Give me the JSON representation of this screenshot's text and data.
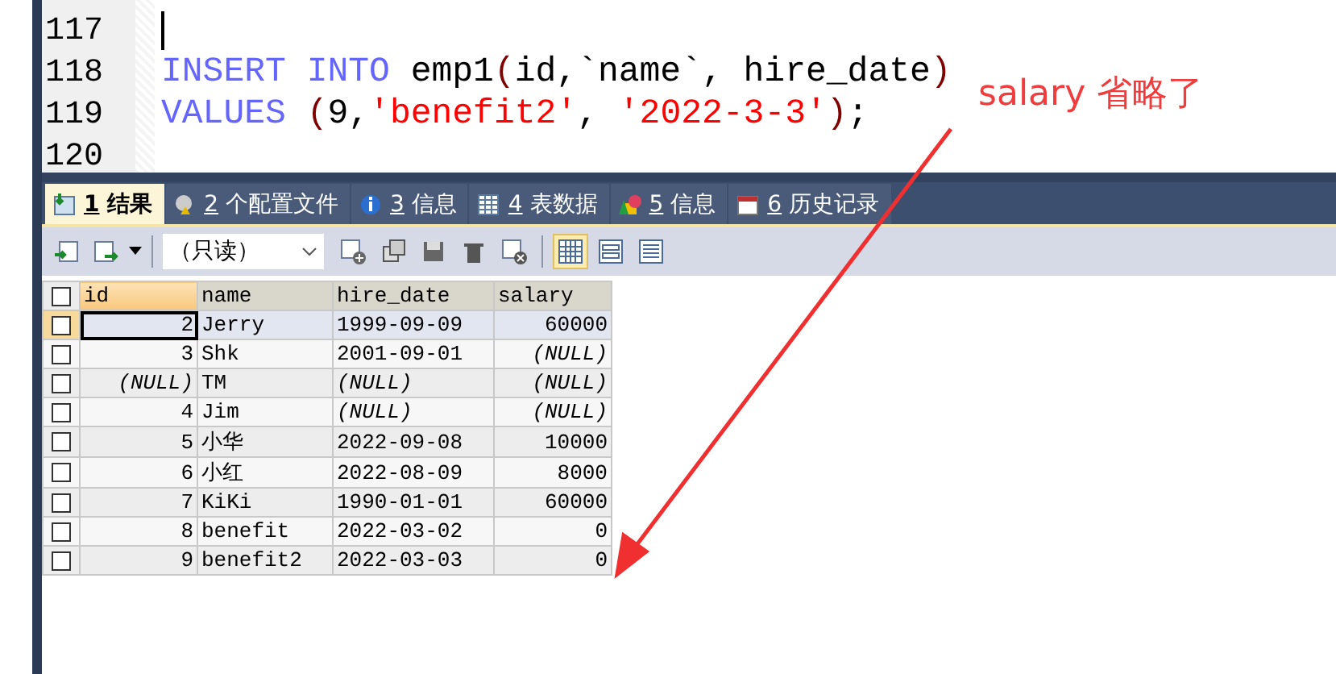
{
  "editor": {
    "lines": [
      {
        "number": "117",
        "cursor": true
      },
      {
        "number": "118",
        "cursor": false,
        "tokens": [
          {
            "kind": "keyword",
            "text": "INSERT INTO"
          },
          {
            "kind": "plain",
            "text": " emp1"
          },
          {
            "kind": "paren",
            "text": "("
          },
          {
            "kind": "plain",
            "text": "id,`name`, hire_date"
          },
          {
            "kind": "paren",
            "text": ")"
          }
        ]
      },
      {
        "number": "119",
        "cursor": false,
        "tokens": [
          {
            "kind": "keyword",
            "text": "VALUES"
          },
          {
            "kind": "paren",
            "text": " ("
          },
          {
            "kind": "plain",
            "text": "9,"
          },
          {
            "kind": "string",
            "text": "'benefit2'"
          },
          {
            "kind": "plain",
            "text": ", "
          },
          {
            "kind": "string",
            "text": "'2022-3-3'"
          },
          {
            "kind": "paren",
            "text": ")"
          },
          {
            "kind": "plain",
            "text": ";"
          }
        ]
      },
      {
        "number": "120",
        "cursor": false
      }
    ]
  },
  "annotation": {
    "text": "salary 省略了"
  },
  "tabs": [
    {
      "kind": "result",
      "number": "1",
      "label": "结果",
      "selected": true
    },
    {
      "kind": "profile",
      "number": "2",
      "label": "个配置文件",
      "selected": false
    },
    {
      "kind": "info",
      "number": "3",
      "label": "信息",
      "selected": false
    },
    {
      "kind": "table",
      "number": "4",
      "label": "表数据",
      "selected": false
    },
    {
      "kind": "shapes",
      "number": "5",
      "label": "信息",
      "selected": false
    },
    {
      "kind": "calendar",
      "number": "6",
      "label": "历史记录",
      "selected": false
    }
  ],
  "toolbar": {
    "mode": "（只读）",
    "views": [
      {
        "kind": "grid",
        "selected": true
      },
      {
        "kind": "form",
        "selected": false
      },
      {
        "kind": "text",
        "selected": false
      }
    ]
  },
  "grid": {
    "all_checked": false,
    "columns": [
      {
        "label": "id",
        "kind": "number",
        "selected": true
      },
      {
        "label": "name",
        "kind": "text",
        "selected": false
      },
      {
        "label": "hire_date",
        "kind": "text",
        "selected": false
      },
      {
        "label": "salary",
        "kind": "number",
        "selected": false
      }
    ],
    "rows": [
      {
        "selected": true,
        "checked": false,
        "cells": [
          {
            "text": "2",
            "null": false
          },
          {
            "text": "Jerry",
            "null": false
          },
          {
            "text": "1999-09-09",
            "null": false
          },
          {
            "text": "60000",
            "null": false
          }
        ]
      },
      {
        "selected": false,
        "checked": false,
        "cells": [
          {
            "text": "3",
            "null": false
          },
          {
            "text": "Shk",
            "null": false
          },
          {
            "text": "2001-09-01",
            "null": false
          },
          {
            "text": "(NULL)",
            "null": true
          }
        ]
      },
      {
        "selected": false,
        "checked": false,
        "cells": [
          {
            "text": "(NULL)",
            "null": true
          },
          {
            "text": "TM",
            "null": false
          },
          {
            "text": "(NULL)",
            "null": true
          },
          {
            "text": "(NULL)",
            "null": true
          }
        ]
      },
      {
        "selected": false,
        "checked": false,
        "cells": [
          {
            "text": "4",
            "null": false
          },
          {
            "text": "Jim",
            "null": false
          },
          {
            "text": "(NULL)",
            "null": true
          },
          {
            "text": "(NULL)",
            "null": true
          }
        ]
      },
      {
        "selected": false,
        "checked": false,
        "cells": [
          {
            "text": "5",
            "null": false
          },
          {
            "text": "小华",
            "null": false
          },
          {
            "text": "2022-09-08",
            "null": false
          },
          {
            "text": "10000",
            "null": false
          }
        ]
      },
      {
        "selected": false,
        "checked": false,
        "cells": [
          {
            "text": "6",
            "null": false
          },
          {
            "text": "小红",
            "null": false
          },
          {
            "text": "2022-08-09",
            "null": false
          },
          {
            "text": "8000",
            "null": false
          }
        ]
      },
      {
        "selected": false,
        "checked": false,
        "cells": [
          {
            "text": "7",
            "null": false
          },
          {
            "text": "KiKi",
            "null": false
          },
          {
            "text": "1990-01-01",
            "null": false
          },
          {
            "text": "60000",
            "null": false
          }
        ]
      },
      {
        "selected": false,
        "checked": false,
        "cells": [
          {
            "text": "8",
            "null": false
          },
          {
            "text": "benefit",
            "null": false
          },
          {
            "text": "2022-03-02",
            "null": false
          },
          {
            "text": "0",
            "null": false
          }
        ]
      },
      {
        "selected": false,
        "checked": false,
        "cells": [
          {
            "text": "9",
            "null": false
          },
          {
            "text": "benefit2",
            "null": false
          },
          {
            "text": "2022-03-03",
            "null": false
          },
          {
            "text": "0",
            "null": false
          }
        ]
      }
    ]
  }
}
